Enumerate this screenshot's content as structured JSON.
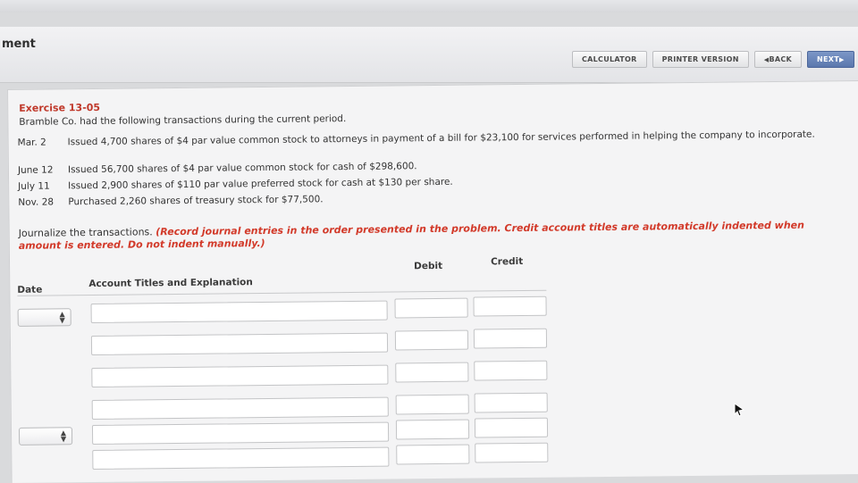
{
  "header": {
    "module_title": "ment",
    "toolbar": {
      "calculator": "CALCULATOR",
      "printer": "PRINTER VERSION",
      "back": "BACK",
      "next": "NEXT"
    }
  },
  "exercise": {
    "title": "Exercise 13-05",
    "intro": "Bramble Co. had the following transactions during the current period.",
    "transactions": [
      {
        "date": "Mar.  2",
        "text": "Issued 4,700 shares of $4 par value common stock to attorneys in payment of a bill for $23,100 for services performed in helping the company to incorporate."
      },
      {
        "date": "June 12",
        "text": "Issued 56,700 shares of $4 par value common stock for cash of $298,600."
      },
      {
        "date": "July 11",
        "text": "Issued 2,900 shares of $110 par value preferred stock for cash at $130 per share."
      },
      {
        "date": "Nov. 28",
        "text": "Purchased 2,260 shares of treasury stock for $77,500."
      }
    ],
    "instruction_plain": "Journalize the transactions. ",
    "instruction_red": "(Record journal entries in the order presented in the problem. Credit account titles are automatically indented when amount is entered. Do not indent manually.)"
  },
  "table": {
    "headers": {
      "date": "Date",
      "account": "Account Titles and Explanation",
      "debit": "Debit",
      "credit": "Credit"
    }
  },
  "icons": {
    "select_arrows": "updown-arrows-icon",
    "cursor": "mouse-pointer-icon"
  },
  "colors": {
    "exercise_title": "#c0392b",
    "instruction_red": "#d23a2a",
    "next_button": "#5a77ad"
  }
}
